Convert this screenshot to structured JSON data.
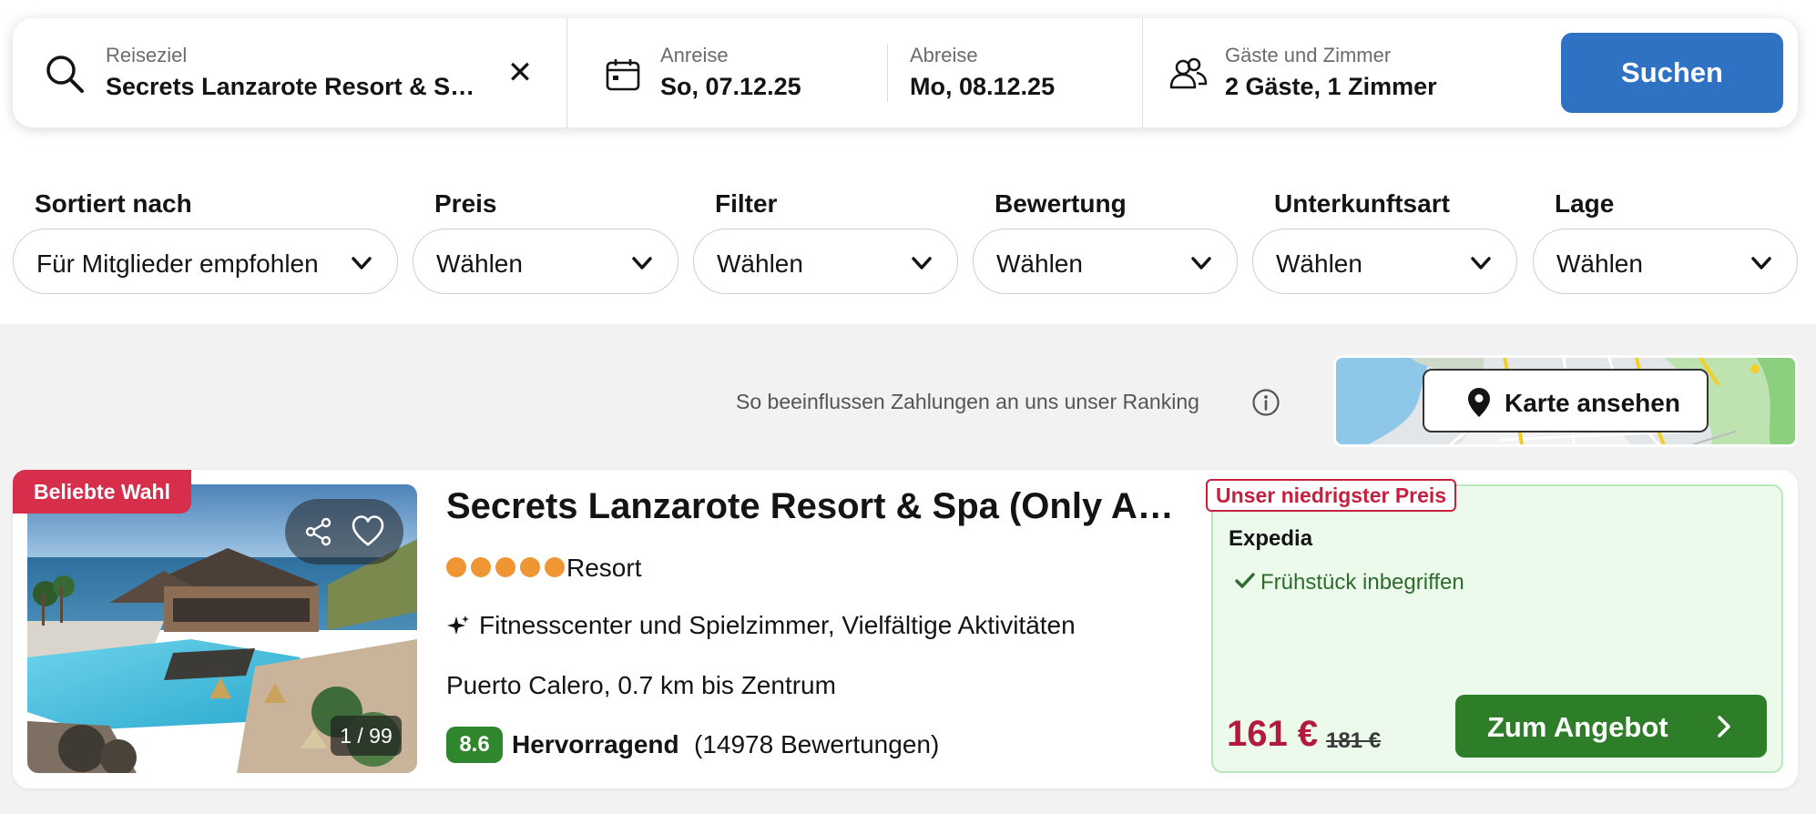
{
  "search": {
    "destination_label": "Reiseziel",
    "destination_value": "Secrets Lanzarote Resort & Spa (Only Adults)",
    "checkin_label": "Anreise",
    "checkin_value": "So, 07.12.25",
    "checkout_label": "Abreise",
    "checkout_value": "Mo, 08.12.25",
    "guests_label": "Gäste und Zimmer",
    "guests_value": "2 Gäste, 1 Zimmer",
    "clear_glyph": "✕",
    "search_button": "Suchen",
    "colors": {
      "button": "#2f72c4"
    }
  },
  "filters": [
    {
      "label": "Sortiert nach",
      "value": "Für Mitglieder empfohlen"
    },
    {
      "label": "Preis",
      "value": "Wählen"
    },
    {
      "label": "Filter",
      "value": "Wählen"
    },
    {
      "label": "Bewertung",
      "value": "Wählen"
    },
    {
      "label": "Unterkunftsart",
      "value": "Wählen"
    },
    {
      "label": "Lage",
      "value": "Wählen"
    }
  ],
  "ranking_note": "So beeinflussen Zahlungen an uns unser Ranking",
  "map": {
    "button_label": "Karte ansehen"
  },
  "hotel": {
    "badge": "Beliebte Wahl",
    "name": "Secrets Lanzarote Resort & Spa (Only Adults)",
    "star_count": 5,
    "type": "Resort",
    "amenities": "Fitnesscenter und Spielzimmer, Vielfältige Aktivitäten",
    "location": "Puerto Calero, 0.7 km bis Zentrum",
    "rating_score": "8.6",
    "rating_word": "Hervorragend",
    "rating_count": "(14978 Bewertungen)",
    "photo_counter": "1 / 99",
    "colors": {
      "badge": "#d62e4b",
      "stars": "#ef9534",
      "rating": "#2f862d"
    }
  },
  "offer": {
    "badge": "Unser niedrigster Preis",
    "provider": "Expedia",
    "perk": "Frühstück inbegriffen",
    "price": "161 €",
    "old_price": "181 €",
    "button": "Zum Angebot",
    "colors": {
      "price": "#b3193b",
      "button": "#2e7d28",
      "badge": "#c7203e"
    }
  }
}
